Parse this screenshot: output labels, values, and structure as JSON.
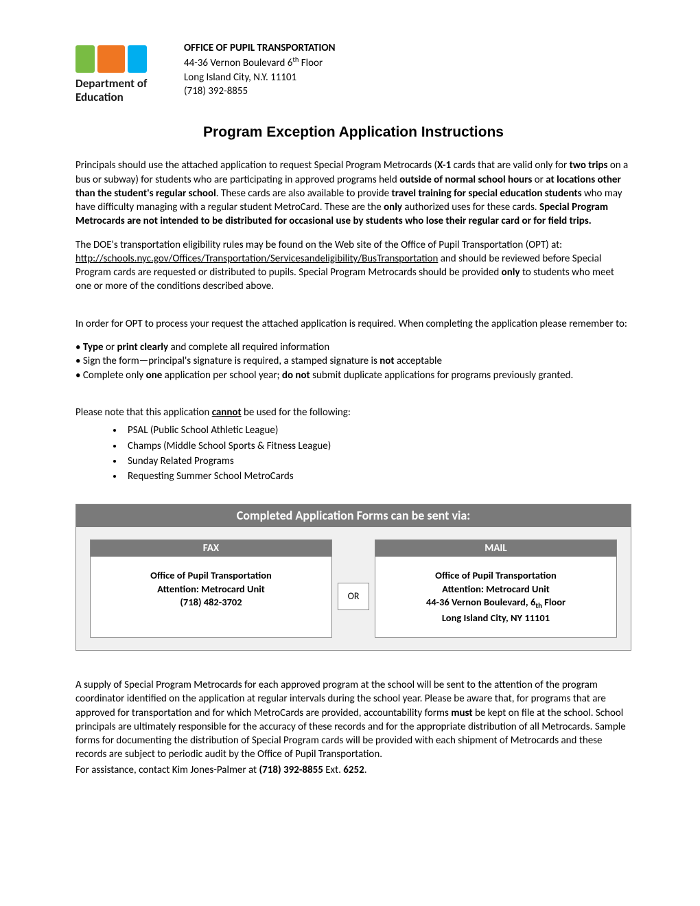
{
  "logo": {
    "line1": "Department of",
    "line2": "Education"
  },
  "office": {
    "title": "OFFICE OF PUPIL TRANSPORTATION",
    "addr1_pre": "44-36 Vernon Boulevard 6",
    "addr1_sup": "th",
    "addr1_post": " Floor",
    "addr2": "Long Island City, N.Y. 11101",
    "phone": "(718) 392-8855"
  },
  "title": "Program Exception Application Instructions",
  "p1": {
    "a": " Principals should use the attached application to request Special Program Metrocards (",
    "b": "X-1",
    "c": " cards that are valid only for ",
    "d": "two trips",
    "e": " on a bus or subway) for students who are participating in approved programs held ",
    "f": "outside of normal school hours",
    "g": " or ",
    "h": "at locations other than the student's regular school",
    "i": ". These cards are also available to provide ",
    "j": "travel training for special education students",
    "k": " who may have difficulty managing with a regular student MetroCard. These are the ",
    "l": "only",
    "m": " authorized uses for these cards. ",
    "n": "Special Program Metrocards are not intended to be distributed for occasional use by students who lose their regular card or for field trips."
  },
  "p2": {
    "a": "The DOE's transportation eligibility rules may be found on the Web site of the Office of Pupil Transportation (OPT) at: ",
    "link": "http://schools.nyc.gov/Offices/Transportation/Servicesandeligibility/BusTransportation",
    "b": " and should be reviewed before Special Program cards are requested or distributed to pupils. Special Program Metrocards should be provided ",
    "c": "only",
    "d": " to students who meet one or more of the conditions described above."
  },
  "p3": " In order for OPT to process your request the attached application is required. When completing the application please remember to:",
  "tips": {
    "t1a": "• ",
    "t1b": "Type",
    "t1c": " or ",
    "t1d": "print clearly",
    "t1e": " and complete all required information",
    "t2a": "• Sign the form—principal's signature is required, a stamped signature is ",
    "t2b": "not",
    "t2c": " acceptable",
    "t3a": "• Complete only ",
    "t3b": "one",
    "t3c": " application per school year; ",
    "t3d": "do not",
    "t3e": " submit duplicate applications for programs previously granted."
  },
  "p4a": "Please note that this application ",
  "p4b": "cannot",
  "p4c": " be used for the following:",
  "restrict": [
    "PSAL (Public School Athletic League)",
    "Champs (Middle School Sports & Fitness League)",
    "Sunday Related Programs",
    "Requesting Summer School MetroCards"
  ],
  "send": {
    "header": "Completed Application Forms can be sent via:",
    "fax_head": "FAX",
    "mail_head": "MAIL",
    "or": "OR",
    "fax_l1": "Office of Pupil Transportation",
    "fax_l2": "Attention: Metrocard Unit",
    "fax_l3": "(718) 482-3702",
    "mail_l1": "Office of Pupil Transportation",
    "mail_l2": "Attention: Metrocard Unit",
    "mail_l3a": "44-36 Vernon Boulevard, 6",
    "mail_l3b": "th",
    "mail_l3c": " Floor",
    "mail_l4": "Long Island City, NY 11101"
  },
  "p5": {
    "a": "A supply of Special Program Metrocards for each approved program at the school will be sent to the attention of the program coordinator identified on the application at regular intervals during the school year. Please be aware that, for programs that are approved for transportation and for which MetroCards are provided, accountability forms ",
    "b": "must",
    "c": " be kept on file at the school. School principals are ultimately responsible for the accuracy of these records and for the appropriate distribution of all Metrocards. Sample forms for documenting the distribution of Special Program cards will be provided with each shipment of Metrocards and these records are subject to periodic audit by the Office of Pupil Transportation."
  },
  "p6": {
    "a": "For assistance, contact Kim Jones-Palmer at ",
    "b": "(718) 392-8855",
    "c": " Ext. ",
    "d": "6252",
    "e": "."
  }
}
